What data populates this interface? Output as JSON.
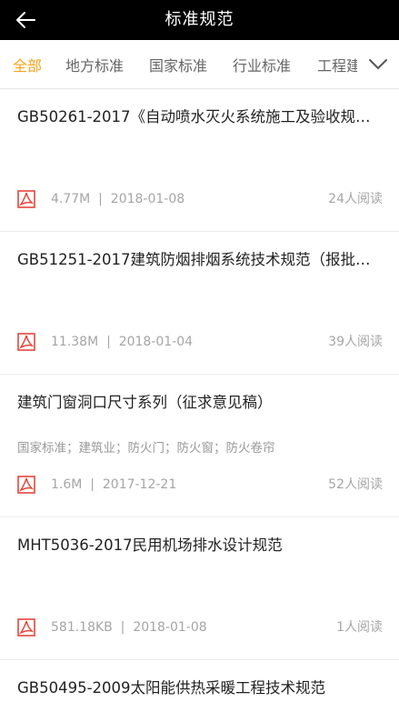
{
  "header": {
    "title": "标准规范"
  },
  "tabs": [
    {
      "label": "全部"
    },
    {
      "label": "地方标准"
    },
    {
      "label": "国家标准"
    },
    {
      "label": "行业标准"
    },
    {
      "label": "工程建"
    }
  ],
  "colors": {
    "accent": "#f5a51e",
    "pdf_red": "#e5463a",
    "header_bg": "#000000"
  },
  "items": [
    {
      "title": "GB50261-2017《自动喷水灭火系统施工及验收规范》",
      "tags": "",
      "size": "4.77M",
      "date": "2018-01-08",
      "reads": "24人阅读"
    },
    {
      "title": "GB51251-2017建筑防烟排烟系统技术规范（报批稿）",
      "tags": "",
      "size": "11.38M",
      "date": "2018-01-04",
      "reads": "39人阅读"
    },
    {
      "title": "建筑门窗洞口尺寸系列（征求意见稿）",
      "tags": "国家标准；建筑业；防火门；防火窗；防火卷帘",
      "size": "1.6M",
      "date": "2017-12-21",
      "reads": "52人阅读"
    },
    {
      "title": "MHT5036-2017民用机场排水设计规范",
      "tags": "",
      "size": "581.18KB",
      "date": "2018-01-08",
      "reads": "1人阅读"
    },
    {
      "title": "GB50495-2009太阳能供热采暖工程技术规范",
      "tags": "",
      "size": "",
      "date": "",
      "reads": ""
    }
  ]
}
